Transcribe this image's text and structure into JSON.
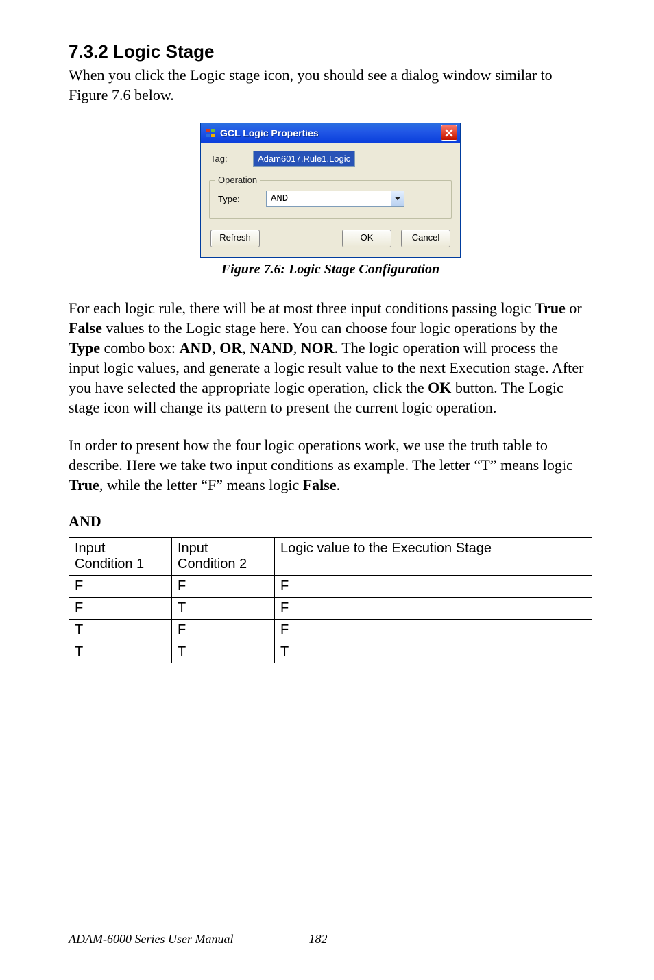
{
  "section": {
    "number": "7.3.2",
    "title": "Logic Stage",
    "heading_full": "7.3.2 Logic Stage"
  },
  "intro": "When you click the Logic stage icon, you should see a dialog window similar to Figure 7.6 below.",
  "dialog": {
    "title": "GCL Logic Properties",
    "tag_label": "Tag:",
    "tag_value": "Adam6017.Rule1.Logic",
    "group_label": "Operation",
    "type_label": "Type:",
    "type_value": "AND",
    "refresh": "Refresh",
    "ok": "OK",
    "cancel": "Cancel"
  },
  "caption": "Figure 7.6: Logic Stage Configuration",
  "para1_parts": {
    "a": "For each logic rule, there will be at most three input conditions passing logic ",
    "b_true": "True",
    "c": " or ",
    "d_false": "False",
    "e": " values to the Logic stage here. You can choose four logic operations by the ",
    "f_type": "Type",
    "g": " combo box: ",
    "h_and": "AND",
    "i": ", ",
    "j_or": "OR",
    "k": ", ",
    "l_nand": "NAND",
    "m": ", ",
    "n_nor": "NOR",
    "o": ". The logic operation will process the input logic values, and generate a logic result value to the next Execution stage. After you have selected the appropriate logic operation, click the ",
    "p_ok": "OK",
    "q": " button. The Logic stage icon will change its pattern to present the current logic operation."
  },
  "para2_parts": {
    "a": "In order to present how the four logic operations work, we use the truth table to describe. Here we take two input conditions as example. The letter “T” means logic ",
    "b_true": "True",
    "c": ", while the letter “F” means logic ",
    "d_false": "False",
    "e": "."
  },
  "truth": {
    "heading": "AND",
    "cols": [
      "Input Condition 1",
      "Input Condition 2",
      "Logic value to the Execution Stage"
    ],
    "rows": [
      [
        "F",
        "F",
        "F"
      ],
      [
        "F",
        "T",
        "F"
      ],
      [
        "T",
        "F",
        "F"
      ],
      [
        "T",
        "T",
        "T"
      ]
    ]
  },
  "footer": {
    "manual": "ADAM-6000 Series User Manual",
    "page": "182"
  }
}
